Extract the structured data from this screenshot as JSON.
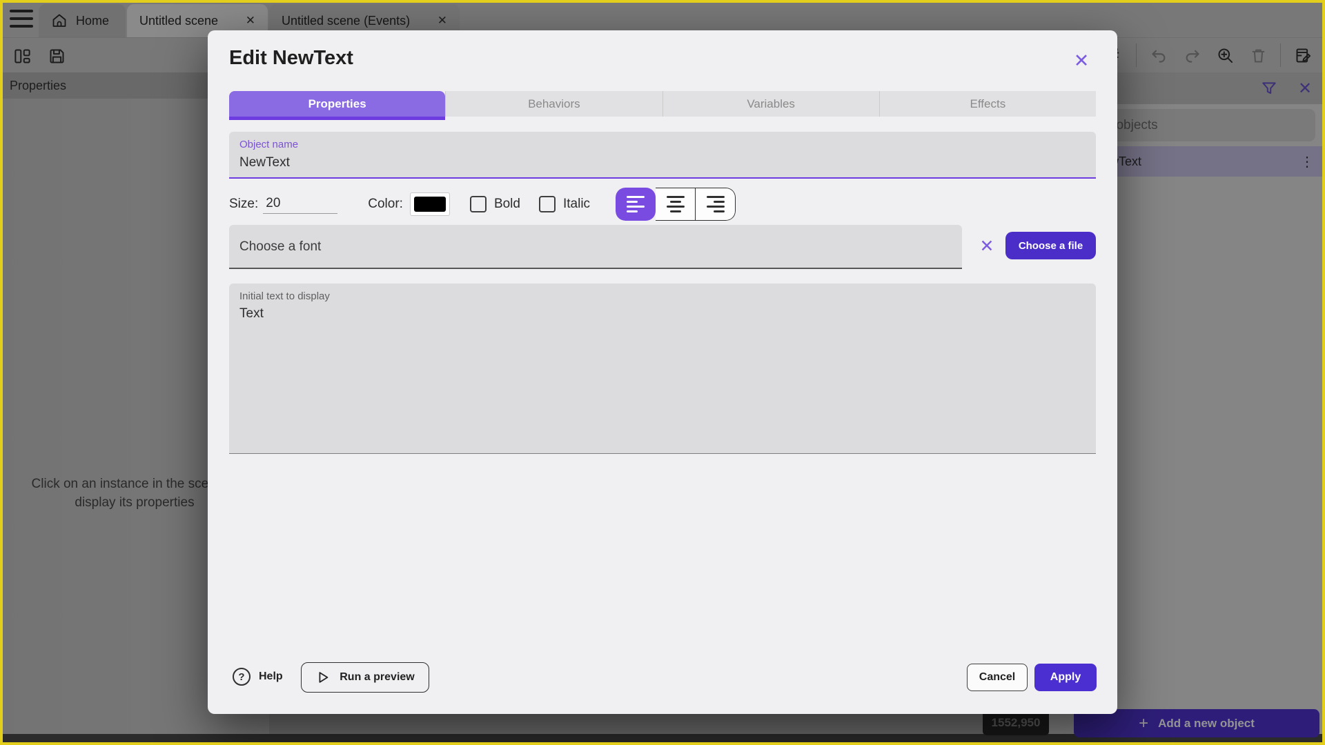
{
  "top_bar": {
    "home_tab": "Home",
    "scene_tab": "Untitled scene",
    "events_tab": "Untitled scene (Events)"
  },
  "left_panel": {
    "title": "Properties",
    "message": "Click on an instance in the scene to display its properties"
  },
  "right_panel": {
    "search_placeholder": "Search objects",
    "object_item": "NewText",
    "coords_badge": "1552,950",
    "add_object_button": "Add a new object"
  },
  "modal": {
    "title": "Edit NewText",
    "tabs": [
      {
        "label": "Properties",
        "selected": true
      },
      {
        "label": "Behaviors",
        "selected": false
      },
      {
        "label": "Variables",
        "selected": false
      },
      {
        "label": "Effects",
        "selected": false
      }
    ],
    "object_name": {
      "label": "Object name",
      "value": "NewText"
    },
    "size_label": "Size:",
    "size_value": "20",
    "color_label": "Color:",
    "color_value": "#000000",
    "bold_label": "Bold",
    "bold_checked": false,
    "italic_label": "Italic",
    "italic_checked": false,
    "alignment_selected": "left",
    "font_field_placeholder": "Choose a font",
    "choose_file_button": "Choose a file",
    "initial_text": {
      "label": "Initial text to display",
      "value": "Text"
    },
    "help_button": "Help",
    "run_preview_button": "Run a preview",
    "cancel_button": "Cancel",
    "apply_button": "Apply"
  },
  "icons": {
    "close_glyph": "✕",
    "dots_glyph": "⋮",
    "plus_glyph": "+",
    "hash_glyph": "#",
    "question_glyph": "?"
  },
  "colors": {
    "accent_underline": "#6c3ce0",
    "tab_selected_bg": "#8b6be4",
    "primary_button": "#4b2fd0",
    "field_bg": "#dcdbdd",
    "modal_bg": "#f0eff1",
    "frame_yellow": "#e3cf1b",
    "purple_icon": "#7b5ce0",
    "text_color_swatch": "#000000"
  }
}
